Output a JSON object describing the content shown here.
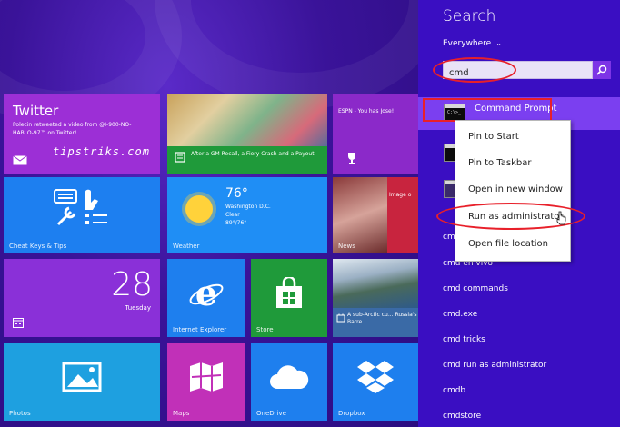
{
  "start_screen": {
    "watermark": "tipstriks.com",
    "tiles": {
      "twitter": {
        "title": "Twitter",
        "message": "Polecin retweeted a video from @I-900-NO-HABLO-97™ on Twitter!"
      },
      "news_photo": {
        "caption": "After a GM Recall, a Fiery Crash and a Payout"
      },
      "espn": {
        "caption": "ESPN - You has Jose!"
      },
      "cheat_keys": {
        "name": "Cheat Keys & Tips"
      },
      "weather": {
        "temperature": "76°",
        "city": "Washington D.C.",
        "condition": "Clear",
        "range": "89°/76°",
        "name": "Weather"
      },
      "news": {
        "caption": "Image o",
        "name": "News"
      },
      "calendar": {
        "day_number": "28",
        "weekday": "Tuesday"
      },
      "internet_explorer": {
        "name": "Internet Explorer"
      },
      "store": {
        "name": "Store"
      },
      "travel": {
        "caption": "A sub-Arctic cu... Russia's Barre..."
      },
      "photos": {
        "name": "Photos"
      },
      "maps": {
        "name": "Maps"
      },
      "onedrive": {
        "name": "OneDrive"
      },
      "dropbox": {
        "name": "Dropbox"
      }
    }
  },
  "search_pane": {
    "title": "Search",
    "scope": "Everywhere",
    "query": "cmd",
    "top_result": "Command Prompt",
    "icon_text": "C:\\>_",
    "results": [
      "cmd",
      "cmd en vivo",
      "cmd commands",
      "cmd.exe",
      "cmd tricks",
      "cmd run as administrator",
      "cmdb",
      "cmdstore"
    ]
  },
  "context_menu": {
    "items": [
      "Pin to Start",
      "Pin to Taskbar",
      "Open in new window",
      "Run as administrator",
      "Open file location"
    ]
  },
  "colors": {
    "start_background": "#3a1399",
    "search_pane": "#3a0ec2",
    "highlight_result": "#7b3ff0",
    "annotation_red": "#e8202a"
  }
}
